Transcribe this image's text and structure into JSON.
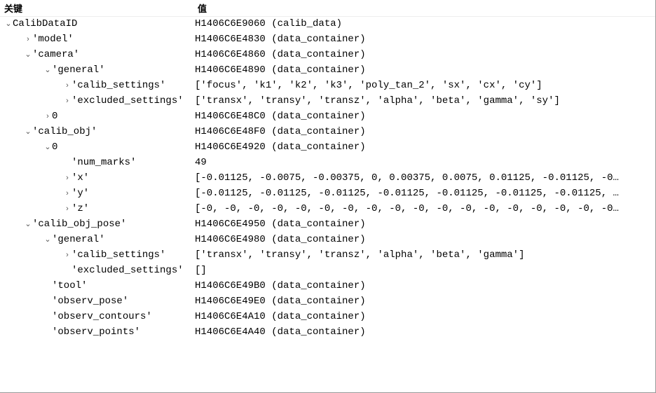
{
  "header": {
    "key_col": "关键",
    "val_col": "值"
  },
  "glyph": {
    "expanded": "⌄",
    "collapsed": "›"
  },
  "rows": [
    {
      "indent": 0,
      "caret": "expanded",
      "key": "CalibDataID",
      "value": "H1406C6E9060 (calib_data)",
      "alt": false,
      "interact": true,
      "name": "node-calibdataid"
    },
    {
      "indent": 1,
      "caret": "collapsed",
      "key": "'model'",
      "value": "H1406C6E4830 (data_container)",
      "alt": true,
      "interact": true,
      "name": "node-model"
    },
    {
      "indent": 1,
      "caret": "expanded",
      "key": "'camera'",
      "value": "H1406C6E4860 (data_container)",
      "alt": false,
      "interact": true,
      "name": "node-camera"
    },
    {
      "indent": 2,
      "caret": "expanded",
      "key": "'general'",
      "value": "H1406C6E4890 (data_container)",
      "alt": true,
      "interact": true,
      "name": "node-camera-general"
    },
    {
      "indent": 3,
      "caret": "collapsed",
      "key": "'calib_settings'",
      "value": "['focus', 'k1', 'k2', 'k3', 'poly_tan_2', 'sx', 'cx', 'cy']",
      "alt": false,
      "interact": true,
      "name": "node-camera-calib-settings"
    },
    {
      "indent": 3,
      "caret": "collapsed",
      "key": "'excluded_settings'",
      "value": "['transx', 'transy', 'transz', 'alpha', 'beta', 'gamma', 'sy']",
      "alt": true,
      "interact": true,
      "name": "node-camera-excluded-settings"
    },
    {
      "indent": 2,
      "caret": "collapsed",
      "key": "0",
      "value": "H1406C6E48C0 (data_container)",
      "alt": false,
      "interact": true,
      "name": "node-camera-0"
    },
    {
      "indent": 1,
      "caret": "expanded",
      "key": "'calib_obj'",
      "value": "H1406C6E48F0 (data_container)",
      "alt": true,
      "interact": true,
      "name": "node-calib-obj"
    },
    {
      "indent": 2,
      "caret": "expanded",
      "key": "0",
      "value": "H1406C6E4920 (data_container)",
      "alt": false,
      "interact": true,
      "name": "node-calib-obj-0"
    },
    {
      "indent": 3,
      "caret": "none",
      "key": "'num_marks'",
      "value": "49",
      "alt": true,
      "interact": true,
      "name": "node-num-marks"
    },
    {
      "indent": 3,
      "caret": "collapsed",
      "key": "'x'",
      "value": "[-0.01125, -0.0075, -0.00375, 0, 0.00375, 0.0075, 0.01125, -0.01125, -0…",
      "alt": false,
      "interact": true,
      "name": "node-x"
    },
    {
      "indent": 3,
      "caret": "collapsed",
      "key": "'y'",
      "value": "[-0.01125, -0.01125, -0.01125, -0.01125, -0.01125, -0.01125, -0.01125, …",
      "alt": true,
      "interact": true,
      "name": "node-y"
    },
    {
      "indent": 3,
      "caret": "collapsed",
      "key": "'z'",
      "value": "[-0, -0, -0, -0, -0, -0, -0, -0, -0, -0, -0, -0, -0, -0, -0, -0, -0, -0…",
      "alt": false,
      "interact": true,
      "name": "node-z"
    },
    {
      "indent": 1,
      "caret": "expanded",
      "key": "'calib_obj_pose'",
      "value": "H1406C6E4950 (data_container)",
      "alt": true,
      "interact": true,
      "name": "node-calib-obj-pose"
    },
    {
      "indent": 2,
      "caret": "expanded",
      "key": "'general'",
      "value": "H1406C6E4980 (data_container)",
      "alt": false,
      "interact": true,
      "name": "node-pose-general"
    },
    {
      "indent": 3,
      "caret": "collapsed",
      "key": "'calib_settings'",
      "value": "['transx', 'transy', 'transz', 'alpha', 'beta', 'gamma']",
      "alt": true,
      "selected": true,
      "interact": true,
      "name": "node-pose-calib-settings"
    },
    {
      "indent": 3,
      "caret": "none",
      "key": "'excluded_settings'",
      "value": "[]",
      "alt": false,
      "interact": true,
      "name": "node-pose-excluded-settings"
    },
    {
      "indent": 2,
      "caret": "none",
      "key": "'tool'",
      "value": "H1406C6E49B0 (data_container)",
      "alt": true,
      "interact": true,
      "name": "node-tool"
    },
    {
      "indent": 2,
      "caret": "none",
      "key": "'observ_pose'",
      "value": "H1406C6E49E0 (data_container)",
      "alt": false,
      "interact": true,
      "name": "node-observ-pose"
    },
    {
      "indent": 2,
      "caret": "none",
      "key": "'observ_contours'",
      "value": "H1406C6E4A10 (data_container)",
      "alt": true,
      "interact": true,
      "name": "node-observ-contours"
    },
    {
      "indent": 2,
      "caret": "none",
      "key": "'observ_points'",
      "value": "H1406C6E4A40 (data_container)",
      "alt": false,
      "interact": true,
      "name": "node-observ-points"
    }
  ]
}
